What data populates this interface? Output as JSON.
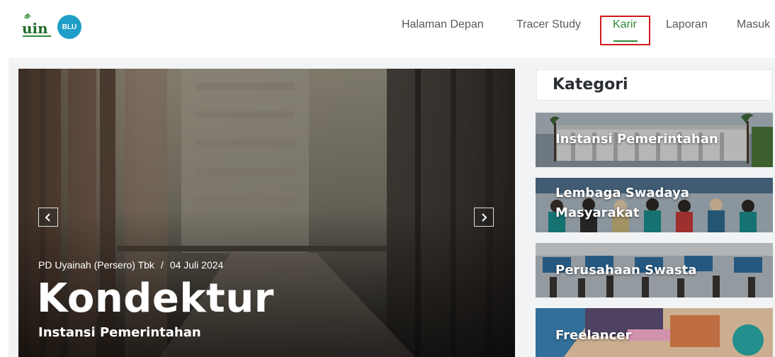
{
  "header": {
    "logo_text": "uin",
    "logo_badge": "BLU",
    "nav": [
      {
        "label": "Halaman Depan",
        "active": false
      },
      {
        "label": "Tracer Study",
        "active": false
      },
      {
        "label": "Karir",
        "active": true
      },
      {
        "label": "Laporan",
        "active": false
      },
      {
        "label": "Masuk",
        "active": false
      }
    ]
  },
  "hero": {
    "company": "PD Uyainah (Persero) Tbk",
    "separator": "/",
    "date": "04 Juli 2024",
    "title": "Kondektur",
    "category": "Instansi Pemerintahan",
    "prev_icon": "chevron-left-icon",
    "next_icon": "chevron-right-icon"
  },
  "sidebar": {
    "title": "Kategori",
    "categories": [
      {
        "line1": "Instansi Pemerintahan",
        "line2": ""
      },
      {
        "line1": "Lembaga Swadaya",
        "line2": "Masyarakat"
      },
      {
        "line1": "Perusahaan Swasta",
        "line2": ""
      },
      {
        "line1": "Freelancer",
        "line2": ""
      }
    ]
  },
  "colors": {
    "accent": "#2e8b3a",
    "highlight": "#d0191f",
    "logo_badge": "#1e9fc7"
  }
}
